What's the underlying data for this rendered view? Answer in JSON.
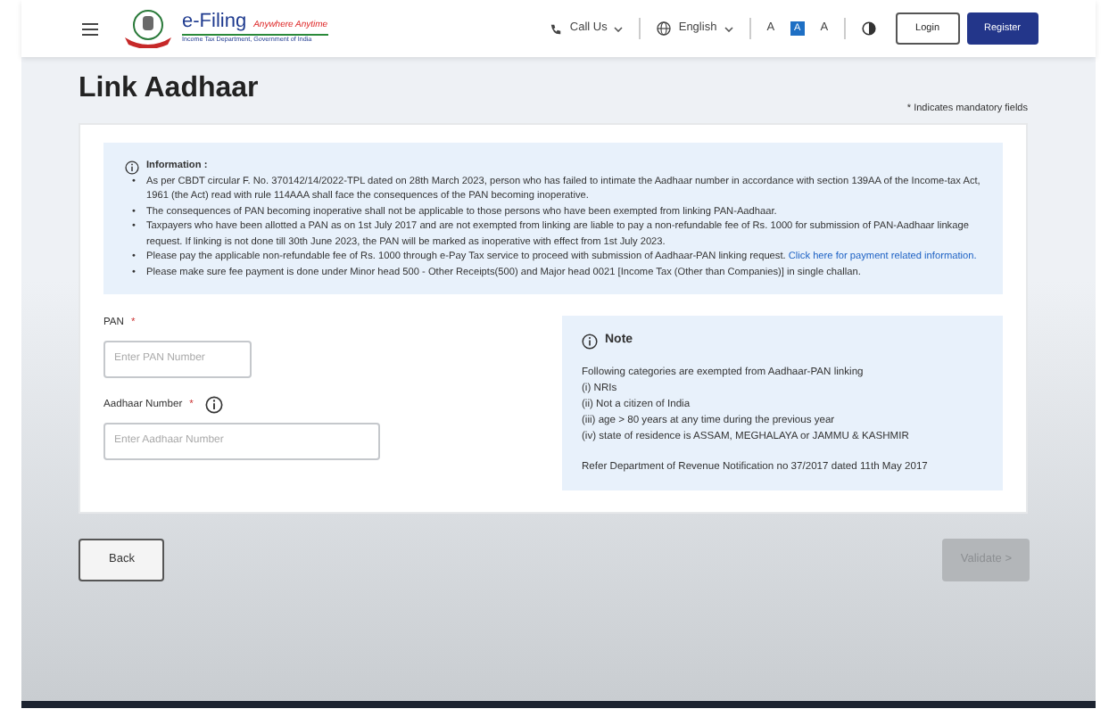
{
  "header": {
    "logo_title": "e-Filing",
    "logo_tagline": "Anywhere Anytime",
    "logo_subtitle": "Income Tax Department, Government of India",
    "call_us": "Call Us",
    "language": "English",
    "font_decrease": "A",
    "font_reset": "A",
    "font_increase": "A",
    "login": "Login",
    "register": "Register"
  },
  "page": {
    "title": "Link Aadhaar",
    "mandatory_note": "* Indicates mandatory fields"
  },
  "information": {
    "heading": "Information :",
    "marker": "•",
    "items": [
      {
        "text": "As per CBDT circular F. No. 370142/14/2022-TPL dated on 28th March 2023, person who has failed to intimate the Aadhaar number in accordance with section 139AA of the Income-tax Act, 1961 (the Act) read with rule 114AAA shall face the consequences of the PAN becoming inoperative."
      },
      {
        "text": "The consequences of PAN becoming inoperative shall not be applicable to those persons who have been exempted from linking PAN-Aadhaar."
      },
      {
        "text": "Taxpayers who have been allotted a PAN as on 1st July 2017 and are not exempted from linking are liable to pay a non-refundable fee of Rs. 1000 for submission of PAN-Aadhaar linkage request. If linking is not done till 30th June 2023, the PAN will be marked as inoperative with effect from 1st July 2023."
      },
      {
        "text": "Please pay the applicable non-refundable fee of Rs. 1000 through e-Pay Tax service to proceed with submission of Aadhaar-PAN linking request.",
        "link": "Click here for payment related information."
      },
      {
        "text": "Please make sure fee payment is done under Minor head 500 - Other Receipts(500) and Major head 0021 [Income Tax (Other than Companies)] in single challan."
      }
    ]
  },
  "form": {
    "fields": [
      {
        "label": "PAN",
        "required_mark": "*",
        "placeholder": "Enter PAN Number",
        "info": false
      },
      {
        "label": "Aadhaar Number",
        "required_mark": "*",
        "placeholder": "Enter Aadhaar Number",
        "info": true
      }
    ]
  },
  "note": {
    "heading": "Note",
    "intro": "Following categories are exempted from Aadhaar-PAN linking",
    "items": [
      "(i) NRIs",
      "(ii) Not a citizen of India",
      "(iii) age > 80 years at any time during the previous year",
      "(iv) state of residence is ASSAM, MEGHALAYA or JAMMU & KASHMIR"
    ],
    "reference": "Refer Department of Revenue Notification no 37/2017 dated 11th May 2017"
  },
  "footer": {
    "back": "Back",
    "validate": "Validate",
    "validate_arrow": ">",
    "validate_disabled": true
  }
}
